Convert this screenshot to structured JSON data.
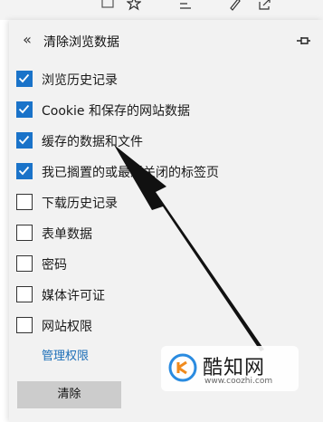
{
  "toolbar": {
    "icons": [
      "reading-view-icon",
      "favorite-star-icon",
      "favorites-hub-icon",
      "notes-pen-icon",
      "share-icon"
    ]
  },
  "panel": {
    "back_icon": "«",
    "title": "清除浏览数据",
    "pin_icon": "pin-icon"
  },
  "options": [
    {
      "label": "浏览历史记录",
      "checked": true
    },
    {
      "label": "Cookie 和保存的网站数据",
      "checked": true
    },
    {
      "label": "缓存的数据和文件",
      "checked": true
    },
    {
      "label": "我已搁置的或最近关闭的标签页",
      "checked": true
    },
    {
      "label": "下载历史记录",
      "checked": false
    },
    {
      "label": "表单数据",
      "checked": false
    },
    {
      "label": "密码",
      "checked": false
    },
    {
      "label": "媒体许可证",
      "checked": false
    },
    {
      "label": "网站权限",
      "checked": false
    }
  ],
  "manage_link": "管理权限",
  "clear_button": "清除",
  "watermark": {
    "name": "酷知网",
    "url": "www.coozhi.com"
  },
  "colors": {
    "accent": "#1a73c9",
    "link": "#1d6fb8",
    "panel_bg": "#f2f2f2",
    "button_bg": "#cccccc"
  }
}
